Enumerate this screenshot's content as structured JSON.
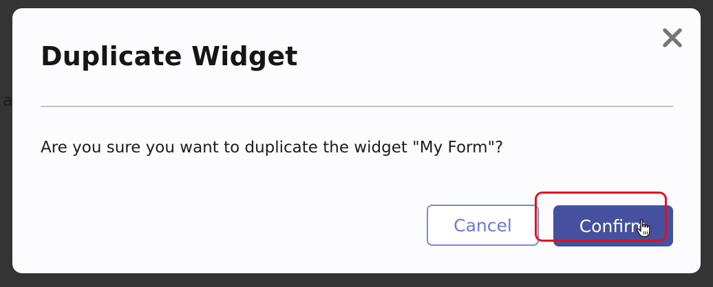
{
  "background": {
    "partial_text": "a"
  },
  "dialog": {
    "title": "Duplicate Widget",
    "message": "Are you sure you want to duplicate the widget \"My Form\"?",
    "close_icon": "close-icon",
    "cancel_label": "Cancel",
    "confirm_label": "Confirm"
  },
  "colors": {
    "overlay": "#343434",
    "dialog_bg": "#fcfcfe",
    "primary": "#45519e",
    "cancel_border": "#7c86d9",
    "cancel_text": "#6c79d4",
    "highlight": "#e01020"
  }
}
